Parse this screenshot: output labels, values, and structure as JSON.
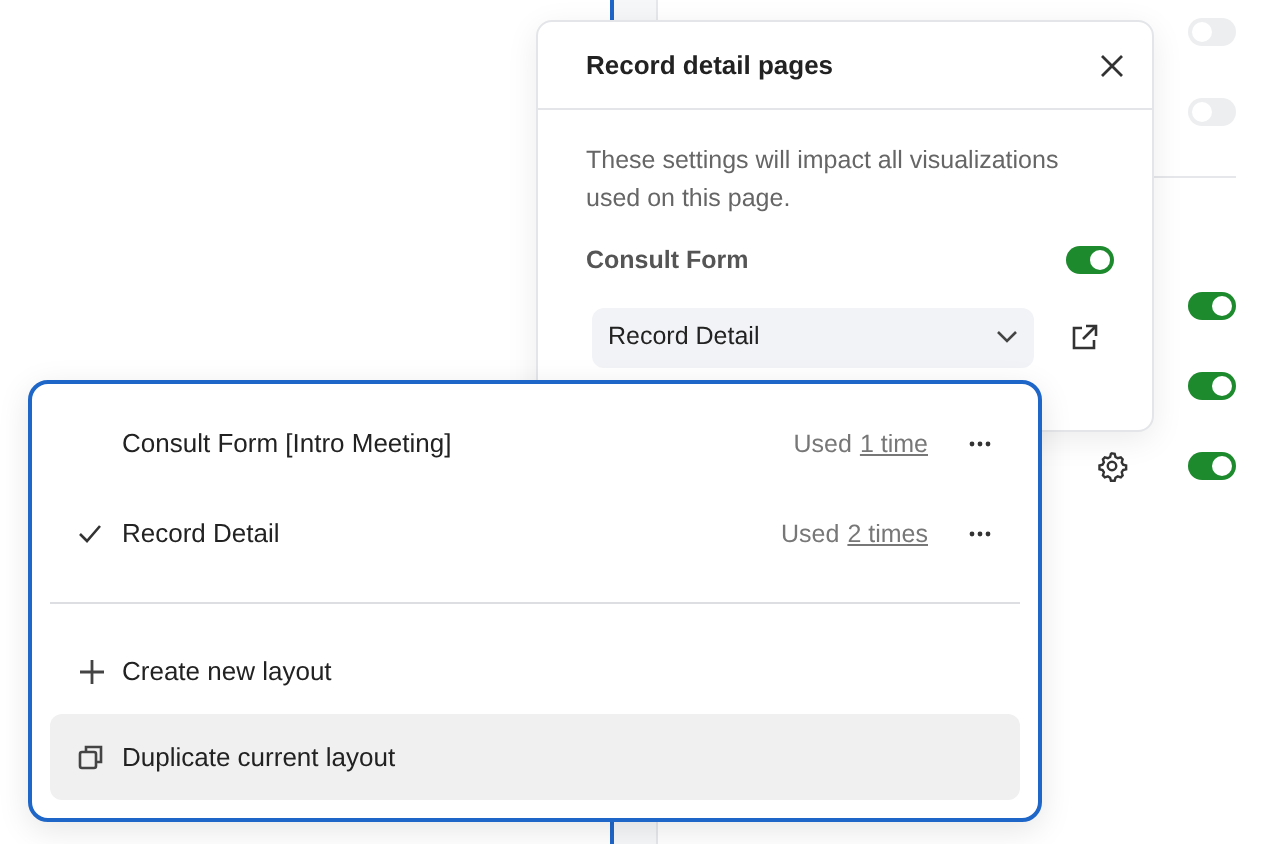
{
  "background": {
    "toggles": [
      {
        "on": false,
        "gear": false
      },
      {
        "on": false,
        "gear": false
      },
      {
        "on": true,
        "gear": false
      },
      {
        "on": true,
        "gear": false
      },
      {
        "on": true,
        "gear": true
      }
    ]
  },
  "popover": {
    "title": "Record detail pages",
    "description": "These settings will impact all visualizations used on this page.",
    "form_label": "Consult Form",
    "form_on": true,
    "select_value": "Record Detail"
  },
  "menu": {
    "layouts": [
      {
        "name": "Consult Form [Intro Meeting]",
        "used_label": "Used",
        "used_link": "1 time",
        "selected": false
      },
      {
        "name": "Record Detail",
        "used_label": "Used",
        "used_link": "2 times",
        "selected": true
      }
    ],
    "actions": [
      {
        "kind": "create",
        "label": "Create new layout",
        "hovered": false
      },
      {
        "kind": "duplicate",
        "label": "Duplicate current layout",
        "hovered": true
      }
    ]
  }
}
